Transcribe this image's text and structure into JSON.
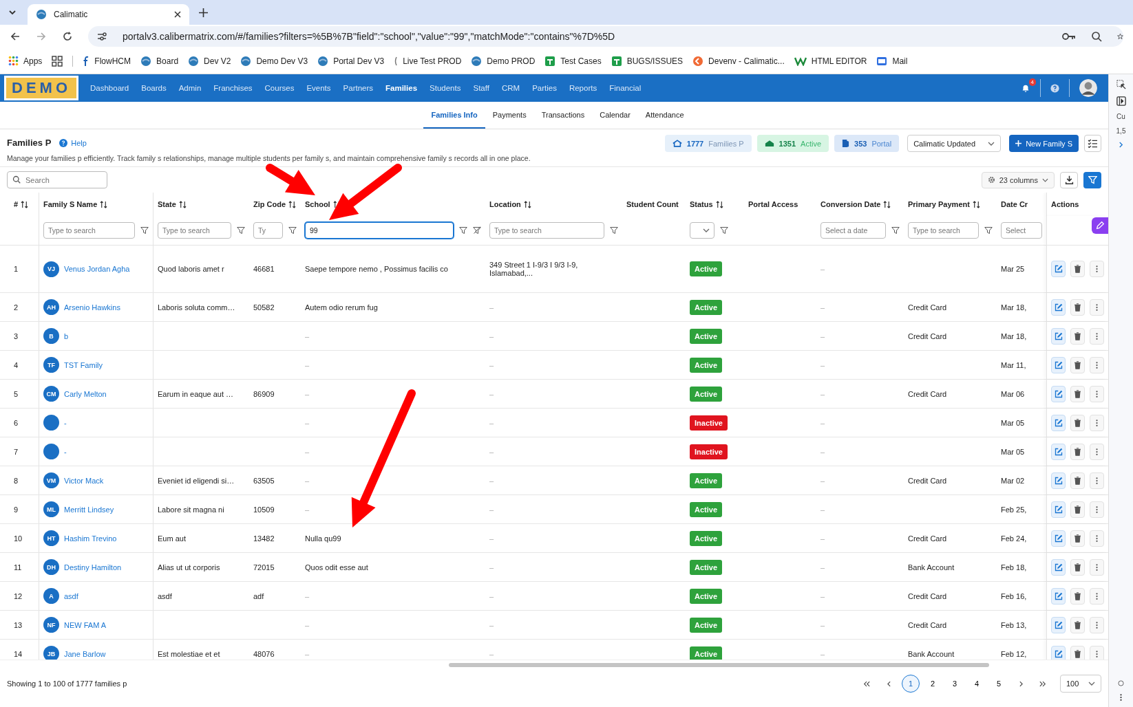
{
  "browser": {
    "tab_title": "Calimatic",
    "url": "portalv3.calibermatrix.com/#/families?filters=%5B%7B\"field\":\"school\",\"value\":\"99\",\"matchMode\":\"contains\"%7D%5D",
    "bookmarks": [
      {
        "label": "Apps",
        "kind": "apps"
      },
      {
        "kind": "grid"
      },
      {
        "label": "FlowHCM",
        "kind": "letter"
      },
      {
        "label": "Board",
        "kind": "globe"
      },
      {
        "label": "Dev V2",
        "kind": "globe"
      },
      {
        "label": "Demo Dev V3",
        "kind": "globe"
      },
      {
        "label": "Portal Dev V3",
        "kind": "globe"
      },
      {
        "label": "Live Test PROD",
        "kind": "sliver"
      },
      {
        "label": "Demo PROD",
        "kind": "globe"
      },
      {
        "label": "Test Cases",
        "kind": "sheet"
      },
      {
        "label": "BUGS/ISSUES",
        "kind": "sheet"
      },
      {
        "label": "Devenv - Calimatic...",
        "kind": "orange"
      },
      {
        "label": "HTML EDITOR",
        "kind": "w"
      },
      {
        "label": "Mail",
        "kind": "mail"
      }
    ]
  },
  "nav": {
    "logo": "DEMO",
    "notification_count": "4",
    "items": [
      {
        "label": "Dashboard",
        "selected": false
      },
      {
        "label": "Boards",
        "selected": false
      },
      {
        "label": "Admin",
        "selected": false
      },
      {
        "label": "Franchises",
        "selected": false
      },
      {
        "label": "Courses",
        "selected": false
      },
      {
        "label": "Events",
        "selected": false
      },
      {
        "label": "Partners",
        "selected": false
      },
      {
        "label": "Families",
        "selected": true
      },
      {
        "label": "Students",
        "selected": false
      },
      {
        "label": "Staff",
        "selected": false
      },
      {
        "label": "CRM",
        "selected": false
      },
      {
        "label": "Parties",
        "selected": false
      },
      {
        "label": "Reports",
        "selected": false
      },
      {
        "label": "Financial",
        "selected": false
      }
    ]
  },
  "subtabs": [
    {
      "label": "Families Info",
      "selected": true
    },
    {
      "label": "Payments",
      "selected": false
    },
    {
      "label": "Transactions",
      "selected": false
    },
    {
      "label": "Calendar",
      "selected": false
    },
    {
      "label": "Attendance",
      "selected": false
    }
  ],
  "header": {
    "title": "Families P",
    "help": "Help",
    "description": "Manage your families p efficiently. Track family s relationships, manage multiple students per family s, and maintain comprehensive family s records all in one place.",
    "stats": [
      {
        "value": "1777",
        "label": "Families P",
        "kind": "total"
      },
      {
        "value": "1351",
        "label": "Active",
        "kind": "active"
      },
      {
        "value": "353",
        "label": "Portal",
        "kind": "portal"
      }
    ],
    "org_select": "Calimatic Updated",
    "new_button": "New Family S"
  },
  "toolbar": {
    "search_placeholder": "Search",
    "columns_button": "23 columns"
  },
  "table": {
    "columns": [
      {
        "label": "#",
        "sortable": true,
        "filter": {
          "kind": "none"
        }
      },
      {
        "label": "Family S Name",
        "sortable": true,
        "filter": {
          "kind": "text",
          "placeholder": "Type to search"
        }
      },
      {
        "label": "State",
        "sortable": true,
        "filter": {
          "kind": "text",
          "placeholder": "Type to search"
        }
      },
      {
        "label": "Zip Code",
        "sortable": true,
        "filter": {
          "kind": "text",
          "placeholder": "Ty"
        }
      },
      {
        "label": "School",
        "sortable": true,
        "filter": {
          "kind": "text",
          "value": "99",
          "focused": true,
          "clearable": true
        }
      },
      {
        "label": "Location",
        "sortable": true,
        "filter": {
          "kind": "text",
          "placeholder": "Type to search"
        }
      },
      {
        "label": "Student Count",
        "sortable": false,
        "filter": {
          "kind": "none"
        }
      },
      {
        "label": "Status",
        "sortable": true,
        "filter": {
          "kind": "select"
        }
      },
      {
        "label": "Portal Access",
        "sortable": false,
        "filter": {
          "kind": "none"
        }
      },
      {
        "label": "Conversion Date",
        "sortable": true,
        "filter": {
          "kind": "date",
          "placeholder": "Select a date"
        }
      },
      {
        "label": "Primary Payment",
        "sortable": true,
        "filter": {
          "kind": "text",
          "placeholder": "Type to search"
        }
      },
      {
        "label": "Date Cr",
        "sortable": false,
        "filter": {
          "kind": "date",
          "placeholder": "Select"
        }
      },
      {
        "label": "Actions",
        "sortable": false,
        "filter": {
          "kind": "none"
        }
      }
    ],
    "rows": [
      {
        "number": "1",
        "initials": "VJ",
        "name": "Venus Jordan Agha",
        "state": "Quod laboris amet r",
        "zip": "46681",
        "school": "Saepe tempore nemo , Possimus facilis co",
        "location": "349 Street 1 I-9/3 I 9/3 I-9, Islamabad,...",
        "status": {
          "label": "Active",
          "kind": "active"
        },
        "conversion_date": "–",
        "date_created": "Mar 25"
      },
      {
        "number": "2",
        "initials": "AH",
        "name": "Arsenio Hawkins",
        "state": "Laboris soluta comm…",
        "zip": "50582",
        "school": "Autem odio rerum fug",
        "location": "–",
        "status": {
          "label": "Active",
          "kind": "active"
        },
        "conversion_date": "–",
        "payment": "Credit Card",
        "date_created": "Mar 18,"
      },
      {
        "number": "3",
        "initials": "B",
        "name": "b",
        "school": "–",
        "location": "–",
        "status": {
          "label": "Active",
          "kind": "active"
        },
        "conversion_date": "–",
        "payment": "Credit Card",
        "date_created": "Mar 18,"
      },
      {
        "number": "4",
        "initials": "TF",
        "name": "TST Family",
        "school": "–",
        "location": "–",
        "status": {
          "label": "Active",
          "kind": "active"
        },
        "conversion_date": "–",
        "date_created": "Mar 11,"
      },
      {
        "number": "5",
        "initials": "CM",
        "name": "Carly Melton",
        "state": "Earum in eaque aut …",
        "zip": "86909",
        "school": "–",
        "location": "–",
        "status": {
          "label": "Active",
          "kind": "active"
        },
        "conversion_date": "–",
        "payment": "Credit Card",
        "date_created": "Mar 06"
      },
      {
        "number": "6",
        "name": "-",
        "school": "–",
        "location": "–",
        "status": {
          "label": "Inactive",
          "kind": "inactive"
        },
        "conversion_date": "–",
        "date_created": "Mar 05"
      },
      {
        "number": "7",
        "name": "-",
        "school": "–",
        "location": "–",
        "status": {
          "label": "Inactive",
          "kind": "inactive"
        },
        "conversion_date": "–",
        "date_created": "Mar 05"
      },
      {
        "number": "8",
        "initials": "VM",
        "name": "Victor Mack",
        "state": "Eveniet id eligendi si…",
        "zip": "63505",
        "school": "–",
        "location": "–",
        "status": {
          "label": "Active",
          "kind": "active"
        },
        "conversion_date": "–",
        "payment": "Credit Card",
        "date_created": "Mar 02"
      },
      {
        "number": "9",
        "initials": "ML",
        "name": "Merritt Lindsey",
        "state": "Labore sit magna ni",
        "zip": "10509",
        "school": "–",
        "location": "–",
        "status": {
          "label": "Active",
          "kind": "active"
        },
        "conversion_date": "–",
        "date_created": "Feb 25,"
      },
      {
        "number": "10",
        "initials": "HT",
        "name": "Hashim Trevino",
        "state": "Eum aut",
        "zip": "13482",
        "school": "Nulla qu99",
        "location": "–",
        "status": {
          "label": "Active",
          "kind": "active"
        },
        "conversion_date": "–",
        "payment": "Credit Card",
        "date_created": "Feb 24,"
      },
      {
        "number": "11",
        "initials": "DH",
        "name": "Destiny Hamilton",
        "state": "Alias ut ut corporis",
        "zip": "72015",
        "school": "Quos odit esse aut",
        "location": "–",
        "status": {
          "label": "Active",
          "kind": "active"
        },
        "conversion_date": "–",
        "payment": "Bank Account",
        "date_created": "Feb 18,"
      },
      {
        "number": "12",
        "initials": "A",
        "name": "asdf",
        "state": "asdf",
        "zip": "adf",
        "school": "–",
        "location": "–",
        "status": {
          "label": "Active",
          "kind": "active"
        },
        "conversion_date": "–",
        "payment": "Credit Card",
        "date_created": "Feb 16,"
      },
      {
        "number": "13",
        "initials": "NF",
        "name": "NEW FAM A",
        "school": "–",
        "location": "–",
        "status": {
          "label": "Active",
          "kind": "active"
        },
        "conversion_date": "–",
        "payment": "Credit Card",
        "date_created": "Feb 13,"
      },
      {
        "number": "14",
        "initials": "JB",
        "name": "Jane Barlow",
        "state": "Est molestiae et et",
        "zip": "48076",
        "school": "–",
        "location": "–",
        "status": {
          "label": "Active",
          "kind": "active"
        },
        "conversion_date": "–",
        "payment": "Bank Account",
        "date_created": "Feb 12,"
      }
    ]
  },
  "footer": {
    "summary": "Showing 1 to 100 of 1777 families p",
    "pages": [
      {
        "label": "1",
        "selected": true
      },
      {
        "label": "2",
        "selected": false
      },
      {
        "label": "3",
        "selected": false
      },
      {
        "label": "4",
        "selected": false
      },
      {
        "label": "5",
        "selected": false
      }
    ],
    "page_size": "100"
  },
  "side_panel": {
    "texts": [
      "Cu",
      "1,5"
    ]
  }
}
